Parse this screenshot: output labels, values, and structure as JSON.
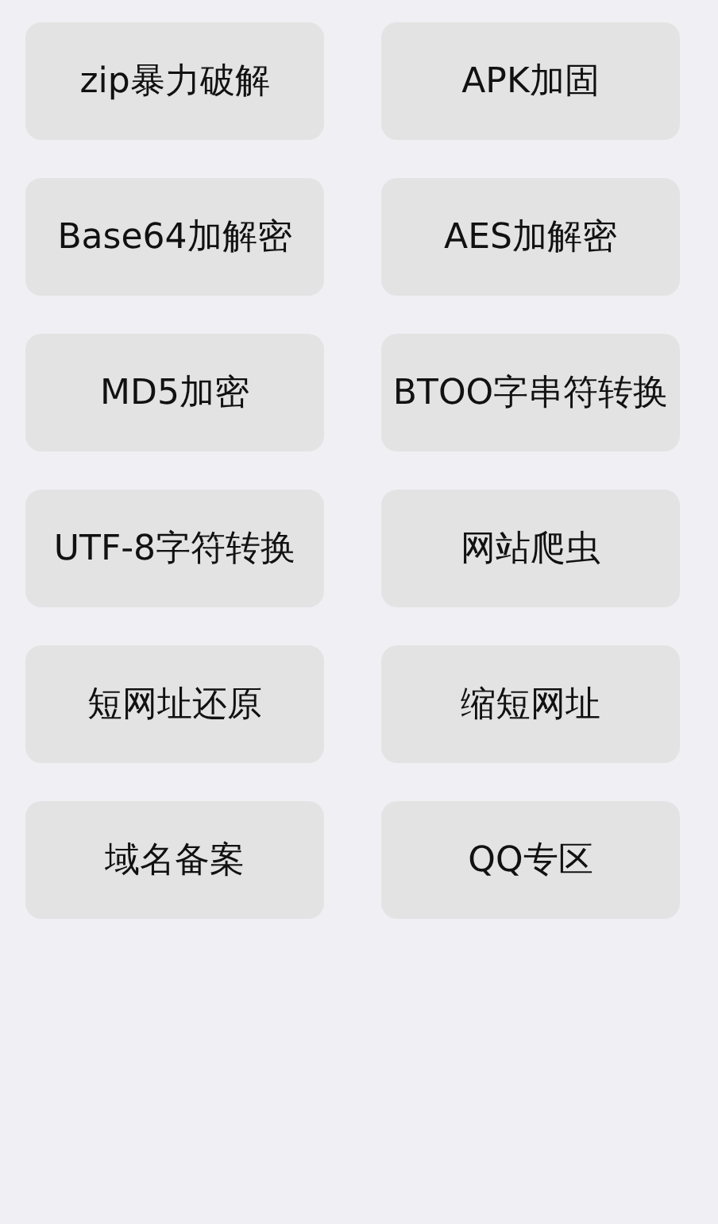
{
  "buttons": [
    {
      "label": "zip暴力破解"
    },
    {
      "label": "APK加固"
    },
    {
      "label": "Base64加解密"
    },
    {
      "label": "AES加解密"
    },
    {
      "label": "MD5加密"
    },
    {
      "label": "BTOO字串符转换"
    },
    {
      "label": "UTF-8字符转换"
    },
    {
      "label": "网站爬虫"
    },
    {
      "label": "短网址还原"
    },
    {
      "label": "缩短网址"
    },
    {
      "label": "域名备案"
    },
    {
      "label": "QQ专区"
    }
  ]
}
